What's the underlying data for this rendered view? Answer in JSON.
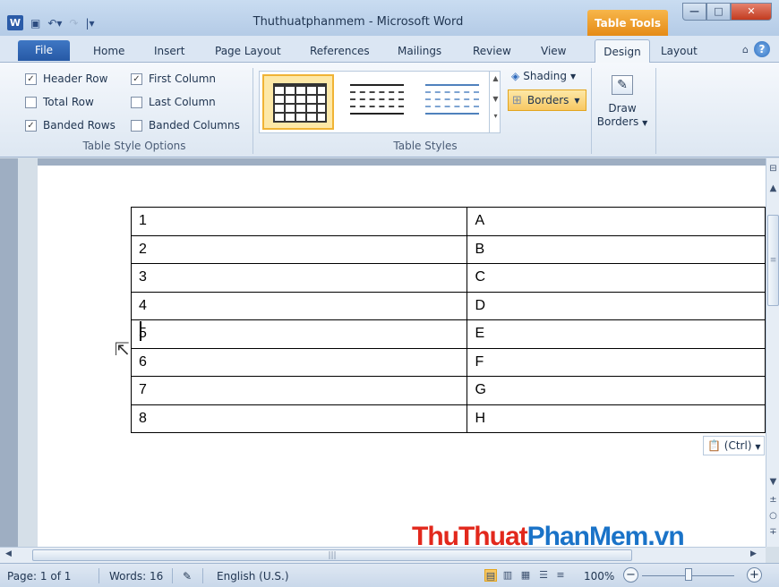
{
  "window": {
    "title": "Thuthuatphanmem - Microsoft Word",
    "context_tab_group": "Table Tools"
  },
  "tabs": [
    "File",
    "Home",
    "Insert",
    "Page Layout",
    "References",
    "Mailings",
    "Review",
    "View",
    "Design",
    "Layout"
  ],
  "ribbon": {
    "table_style_options": {
      "label": "Table Style Options",
      "options": [
        {
          "label": "Header Row",
          "checked": true
        },
        {
          "label": "First Column",
          "checked": true
        },
        {
          "label": "Total Row",
          "checked": false
        },
        {
          "label": "Last Column",
          "checked": false
        },
        {
          "label": "Banded Rows",
          "checked": true
        },
        {
          "label": "Banded Columns",
          "checked": false
        }
      ]
    },
    "table_styles": {
      "label": "Table Styles",
      "shading_label": "Shading",
      "borders_label": "Borders"
    },
    "draw_borders": {
      "label_line1": "Draw",
      "label_line2": "Borders"
    }
  },
  "document": {
    "table": [
      [
        "1",
        "A"
      ],
      [
        "2",
        "B"
      ],
      [
        "3",
        "C"
      ],
      [
        "4",
        "D"
      ],
      [
        "5",
        "E"
      ],
      [
        "6",
        "F"
      ],
      [
        "7",
        "G"
      ],
      [
        "8",
        "H"
      ]
    ],
    "paste_options": "(Ctrl)"
  },
  "watermark": {
    "part1": "ThuThuat",
    "part2": "PhanMem.vn"
  },
  "status_bar": {
    "page": "Page: 1 of 1",
    "words": "Words: 16",
    "language": "English (U.S.)",
    "zoom": "100%"
  },
  "colors": {
    "accent": "#2659a5",
    "context": "#e58b17",
    "watermark_red": "#e2281c",
    "watermark_blue": "#1a73c8"
  }
}
